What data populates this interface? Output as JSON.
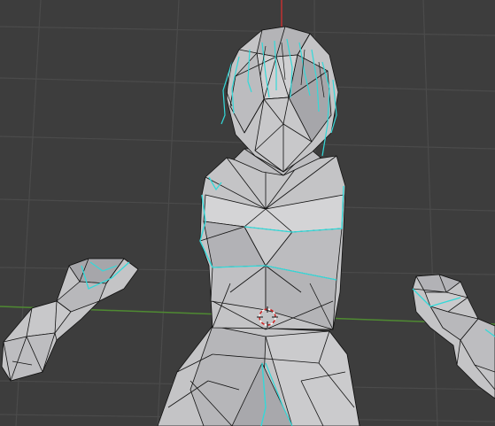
{
  "viewport": {
    "background": "#3d3d3d",
    "grid_color": "#4b4b4b",
    "x_axis_color": "#4f8a32",
    "z_axis_color": "#c23232",
    "mesh_fill": "#c4c4c6",
    "mesh_shadow": "#9e9ea2",
    "mesh_highlight": "#d8d8da",
    "wire_color": "#111111",
    "selection_color": "#33d9d9",
    "cursor_color": "#cc2222"
  }
}
